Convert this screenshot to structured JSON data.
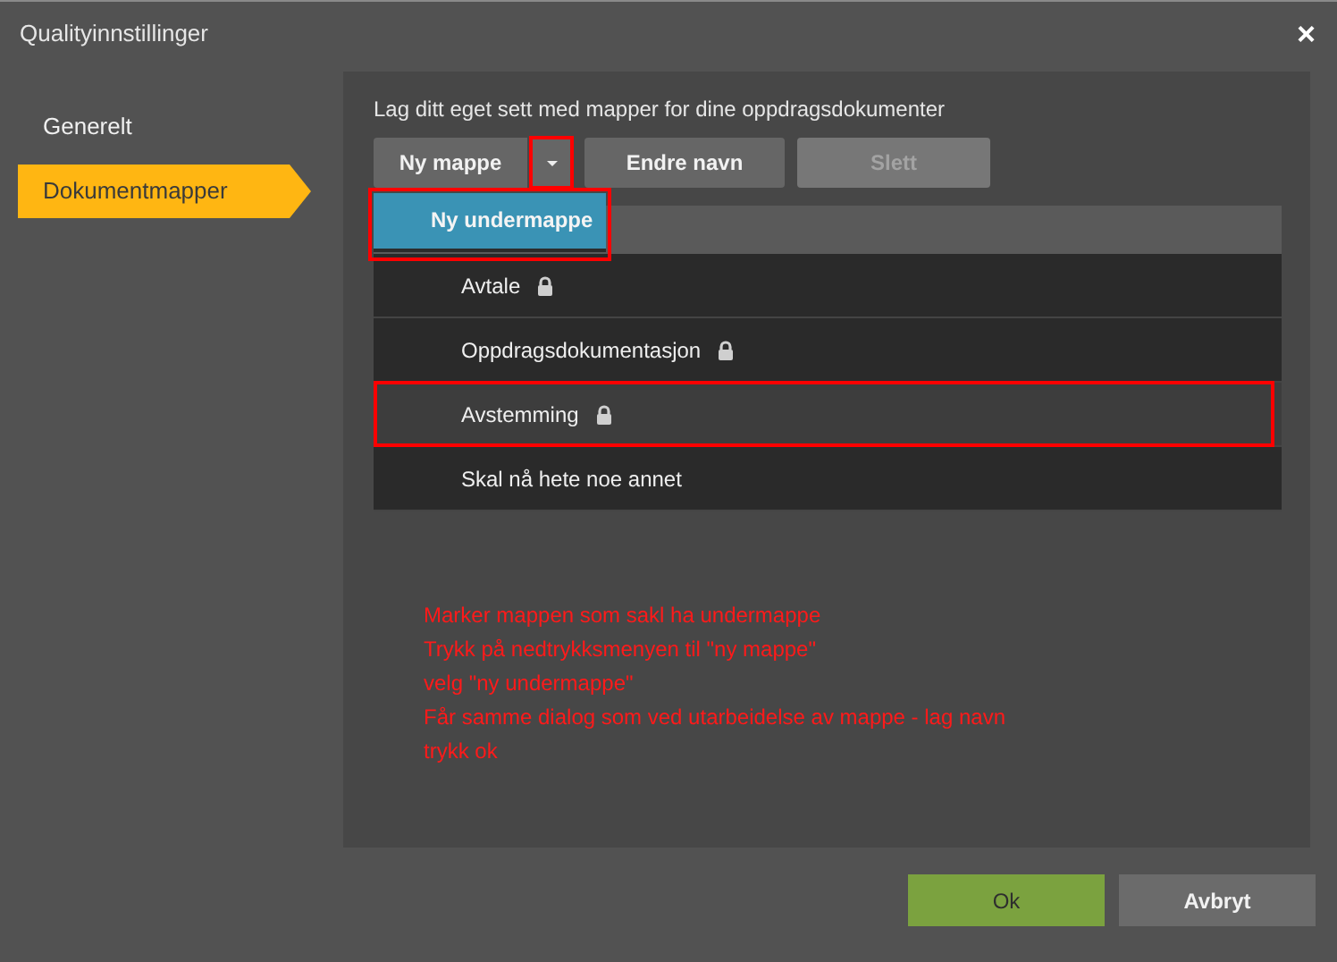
{
  "window": {
    "title": "Qualityinnstillinger",
    "close": "×"
  },
  "sidebar": {
    "items": [
      {
        "label": "Generelt",
        "selected": false
      },
      {
        "label": "Dokumentmapper",
        "selected": true
      }
    ]
  },
  "content": {
    "intro": "Lag ditt eget sett med mapper for dine oppdragsdokumenter",
    "toolbar": {
      "new_folder": {
        "label": "Ny mappe",
        "caret_highlighted": true
      },
      "rename": {
        "label": "Endre navn",
        "disabled": false
      },
      "delete": {
        "label": "Slett",
        "disabled": true
      }
    },
    "dropdown": {
      "items": [
        {
          "label": "Ny undermappe",
          "highlighted": true
        }
      ]
    },
    "folders": [
      {
        "label": "Avtale",
        "locked": true,
        "selected": false,
        "highlighted": false
      },
      {
        "label": "Oppdragsdokumentasjon",
        "locked": true,
        "selected": false,
        "highlighted": false
      },
      {
        "label": "Avstemming",
        "locked": true,
        "selected": true,
        "highlighted": true
      },
      {
        "label": "Skal nå hete noe annet",
        "locked": false,
        "selected": false,
        "highlighted": false
      }
    ],
    "note": [
      "Marker mappen som sakl ha undermappe",
      "Trykk på nedtrykksmenyen til \"ny mappe\"",
      "velg \"ny undermappe\"",
      "Får samme dialog som ved utarbeidelse av mappe - lag navn",
      "trykk ok"
    ]
  },
  "footer": {
    "buttons": [
      {
        "label": "Ok",
        "kind": "primary"
      },
      {
        "label": "Avbryt",
        "kind": "secondary"
      }
    ]
  }
}
